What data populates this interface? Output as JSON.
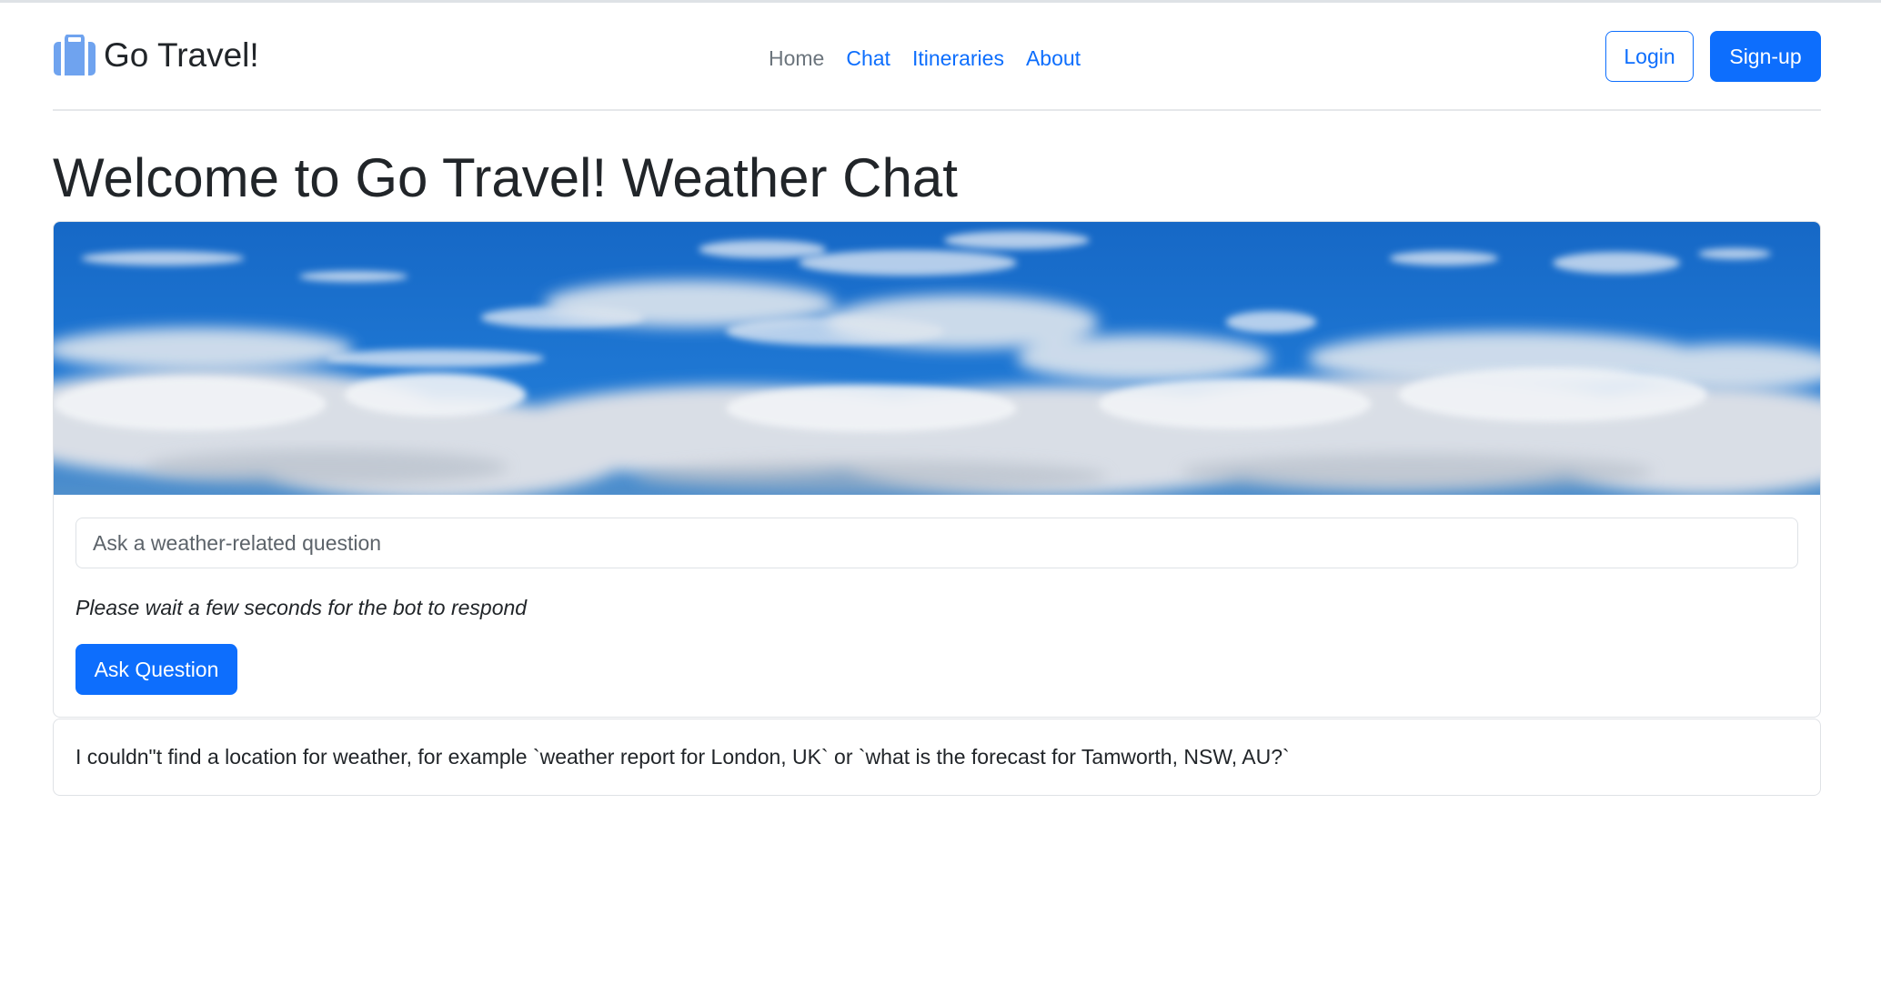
{
  "brand": {
    "name": "Go Travel!",
    "icon": "suitcase-icon"
  },
  "nav": {
    "items": [
      {
        "label": "Home",
        "active": false
      },
      {
        "label": "Chat",
        "active": true
      },
      {
        "label": "Itineraries",
        "active": true
      },
      {
        "label": "About",
        "active": true
      }
    ]
  },
  "auth": {
    "login_label": "Login",
    "signup_label": "Sign-up"
  },
  "page": {
    "title": "Welcome to Go Travel! Weather Chat"
  },
  "chat": {
    "hero_image": "sky-clouds-image",
    "question_placeholder": "Ask a weather-related question",
    "question_value": "",
    "wait_note": "Please wait a few seconds for the bot to respond",
    "ask_button_label": "Ask Question",
    "response": "I couldn\"t find a location for weather, for example `weather report for London, UK` or `what is the forecast for Tamworth, NSW, AU?`"
  },
  "colors": {
    "primary": "#0d6efd",
    "muted_link": "#6c757d",
    "text": "#212529",
    "border": "#dee2e6",
    "sky": "#1a6fc9"
  }
}
